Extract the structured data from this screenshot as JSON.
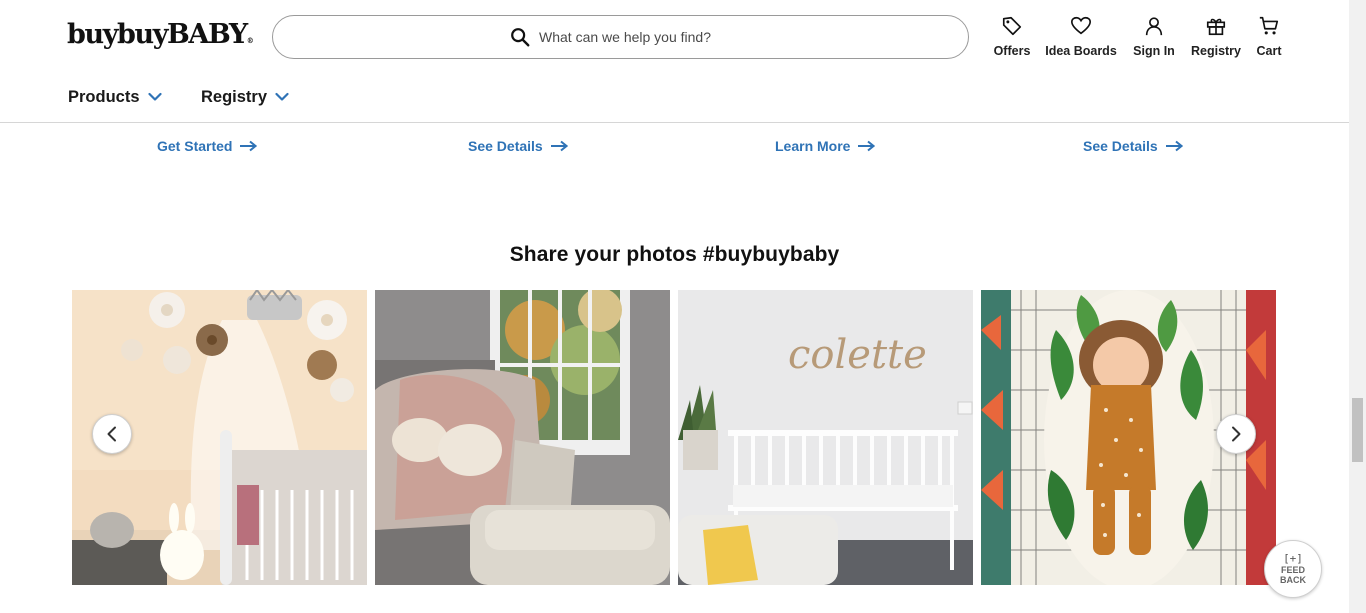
{
  "brand": {
    "name": "buybuyBABY",
    "mark": "®"
  },
  "search": {
    "placeholder": "What can we help you find?",
    "icon": "search-icon"
  },
  "header_icons": [
    {
      "label": "Offers",
      "icon": "tag-icon"
    },
    {
      "label": "Idea Boards",
      "icon": "heart-icon"
    },
    {
      "label": "Sign In",
      "icon": "user-icon"
    },
    {
      "label": "Registry",
      "icon": "gift-icon"
    },
    {
      "label": "Cart",
      "icon": "cart-icon"
    }
  ],
  "menu": [
    {
      "label": "Products",
      "icon": "chevron-down-icon"
    },
    {
      "label": "Registry",
      "icon": "chevron-down-icon"
    }
  ],
  "ctas": [
    {
      "label": "Get Started",
      "icon": "arrow-right-icon"
    },
    {
      "label": "See Details",
      "icon": "arrow-right-icon"
    },
    {
      "label": "Learn More",
      "icon": "arrow-right-icon"
    },
    {
      "label": "See Details",
      "icon": "arrow-right-icon"
    }
  ],
  "gallery": {
    "title": "Share your photos #buybuybaby",
    "photo_text": {
      "name_sign": "colette"
    },
    "prev_icon": "chevron-left-icon",
    "next_icon": "chevron-right-icon"
  },
  "feedback": {
    "icon_text": "[+]",
    "label": "FEED BACK"
  },
  "colors": {
    "link": "#2f73b6",
    "text": "#1a1a1a",
    "border": "#d6d6d6"
  }
}
